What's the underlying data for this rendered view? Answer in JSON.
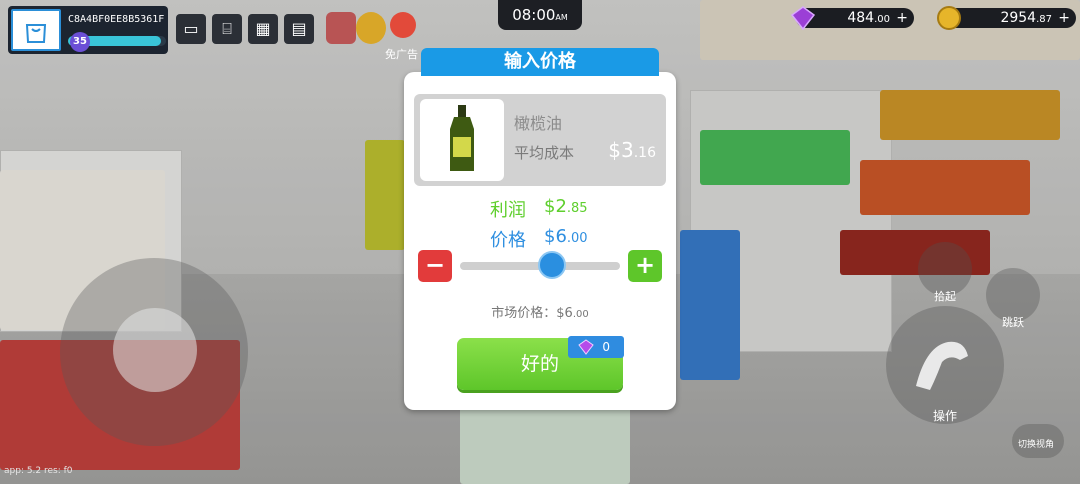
{
  "hud": {
    "player_id": "C8A4BF0EE8B5361F",
    "level": "35",
    "level_progress": 0.95,
    "time": "08:00",
    "time_suffix": "AM",
    "gems_main": "484",
    "gems_dec": ".00",
    "cash_main": "2954",
    "cash_dec": ".87",
    "ad_label": "免广告",
    "icons": [
      "computer-icon",
      "cash-register-icon",
      "grid-menu-icon",
      "money-icon",
      "wheel-icon",
      "no-ads-icon"
    ]
  },
  "modal": {
    "title": "输入价格",
    "product_name": "橄榄油",
    "avg_cost_label": "平均成本",
    "avg_cost_main": "$3",
    "avg_cost_dec": ".16",
    "profit_label": "利润",
    "profit_main": "$2",
    "profit_dec": ".85",
    "price_label": "价格",
    "price_main": "$6",
    "price_dec": ".00",
    "market_label": "市场价格：",
    "market_main": "$6",
    "market_dec": ".00",
    "minus": "−",
    "plus": "+",
    "ok_label": "好的",
    "gem_cost": "0"
  },
  "controls": {
    "pickup_label": "拾起",
    "jump_label": "跳跃",
    "action_label": "操作",
    "camera_label": "切换视角"
  },
  "footer": {
    "version": "app: 5.2 res: f0"
  },
  "colors": {
    "accent_blue": "#1a9ae6",
    "profit_green": "#5fcf2e",
    "price_blue": "#2f8fe0",
    "minus_red": "#e23b3b",
    "plus_green": "#5ec62a"
  }
}
